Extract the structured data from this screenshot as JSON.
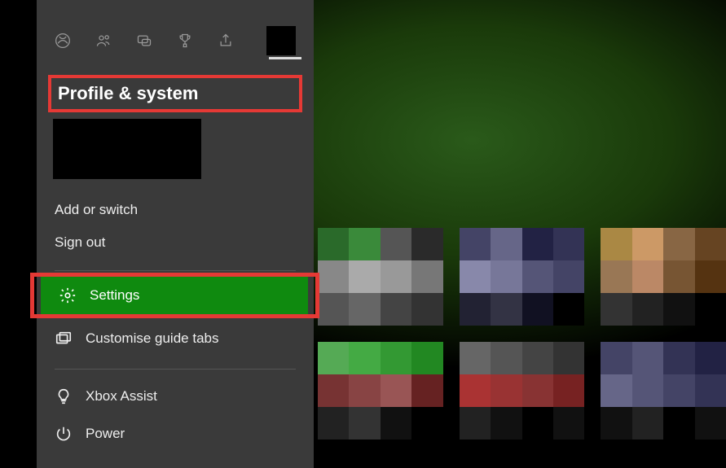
{
  "panel": {
    "title": "Profile & system",
    "tabs": [
      {
        "name": "xbox-logo-icon"
      },
      {
        "name": "people-icon"
      },
      {
        "name": "chat-icon"
      },
      {
        "name": "achievements-icon"
      },
      {
        "name": "share-icon"
      }
    ],
    "account_items": {
      "add_or_switch": "Add or switch",
      "sign_out": "Sign out"
    },
    "menu_items": {
      "settings": "Settings",
      "customise_guide_tabs": "Customise guide tabs",
      "xbox_assist": "Xbox Assist",
      "power": "Power"
    }
  },
  "colors": {
    "panel_bg": "#3a3a3a",
    "selected_green": "#0f8a0f",
    "highlight_red": "#e53935"
  }
}
